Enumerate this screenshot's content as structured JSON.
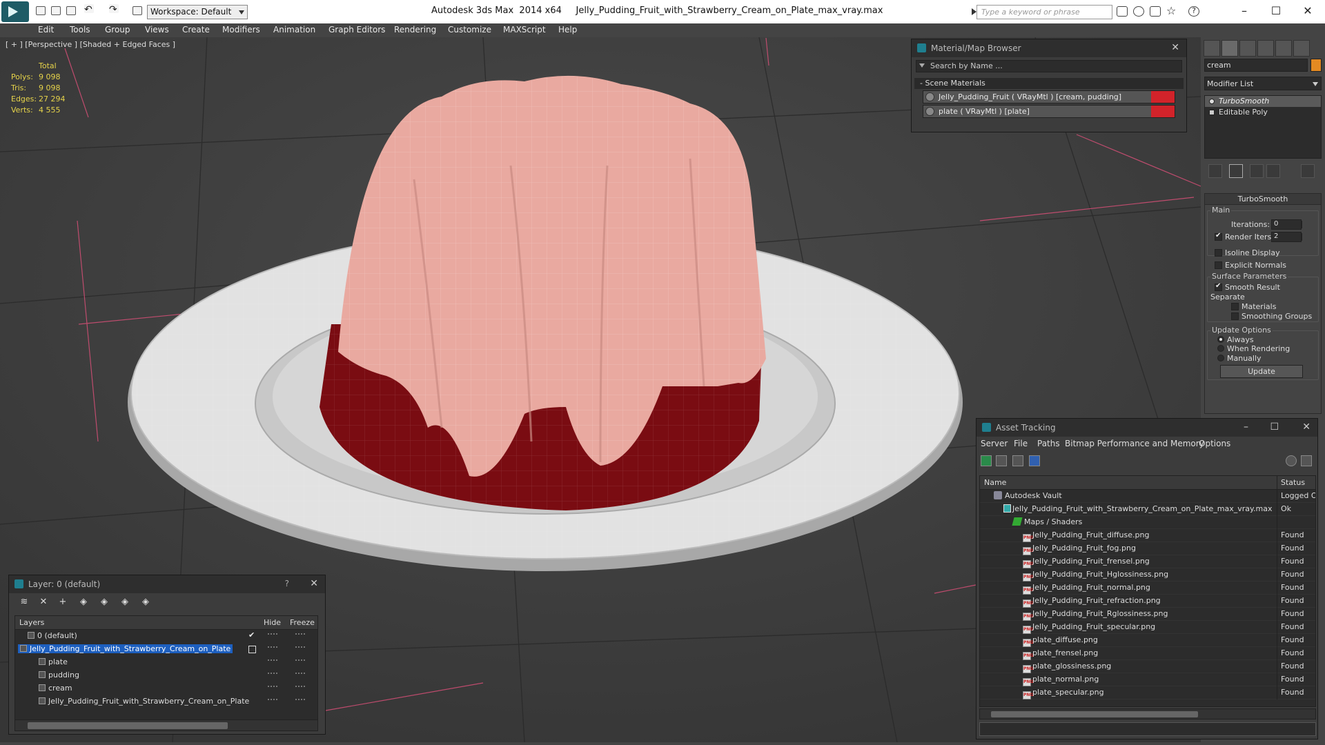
{
  "titlebar": {
    "workspace": "Workspace: Default",
    "app_title": "Autodesk 3ds Max  2014 x64     Jelly_Pudding_Fruit_with_Strawberry_Cream_on_Plate_max_vray.max",
    "search_placeholder": "Type a keyword or phrase"
  },
  "menu": [
    "Edit",
    "Tools",
    "Group",
    "Views",
    "Create",
    "Modifiers",
    "Animation",
    "Graph Editors",
    "Rendering",
    "Customize",
    "MAXScript",
    "Help"
  ],
  "viewport": {
    "label": "[ + ] [Perspective ] [Shaded + Edged Faces ]",
    "stats": {
      "header": "Total",
      "rows": [
        {
          "label": "Polys:",
          "value": "9 098"
        },
        {
          "label": "Tris:",
          "value": "9 098"
        },
        {
          "label": "Edges:",
          "value": "27 294"
        },
        {
          "label": "Verts:",
          "value": "4 555"
        }
      ]
    }
  },
  "material_browser": {
    "title": "Material/Map Browser",
    "search_placeholder": "Search by Name ...",
    "section": "- Scene Materials",
    "materials": [
      {
        "label": "Jelly_Pudding_Fruit  ( VRayMtl )  [cream, pudding]",
        "color": "#d2232a"
      },
      {
        "label": "plate  ( VRayMtl )  [plate]",
        "color": "#d2232a"
      }
    ]
  },
  "command_panel": {
    "object_name": "cream",
    "object_color": "#e48a22",
    "modifier_list": "Modifier List",
    "stack": [
      "TurboSmooth",
      "Editable Poly"
    ],
    "rollout_title": "TurboSmooth",
    "main_label": "Main",
    "iterations_label": "Iterations:",
    "iterations_value": "0",
    "render_iters_label": "Render Iters:",
    "render_iters_value": "2",
    "isoline": "Isoline Display",
    "explicit": "Explicit Normals",
    "surface_label": "Surface Parameters",
    "smooth_result": "Smooth Result",
    "separate_label": "Separate",
    "materials": "Materials",
    "smoothing_groups": "Smoothing Groups",
    "update_label": "Update Options",
    "always": "Always",
    "when_rendering": "When Rendering",
    "manually": "Manually",
    "update_button": "Update"
  },
  "layer_panel": {
    "title": "Layer: 0 (default)",
    "help": "?",
    "columns": {
      "layers": "Layers",
      "hide": "Hide",
      "freeze": "Freeze"
    },
    "rows": [
      {
        "name": "0 (default)",
        "level": 0
      },
      {
        "name": "Jelly_Pudding_Fruit_with_Strawberry_Cream_on_Plate",
        "level": 0
      },
      {
        "name": "plate",
        "level": 1
      },
      {
        "name": "pudding",
        "level": 1
      },
      {
        "name": "cream",
        "level": 1
      },
      {
        "name": "Jelly_Pudding_Fruit_with_Strawberry_Cream_on_Plate",
        "level": 1
      }
    ]
  },
  "asset_tracking": {
    "title": "Asset Tracking",
    "menu": [
      "Server",
      "File",
      "Paths",
      "Bitmap Performance and Memory",
      "Options"
    ],
    "columns": {
      "name": "Name",
      "status": "Status"
    },
    "rows": [
      {
        "name": "Autodesk Vault",
        "status": "Logged O",
        "kind": "vault",
        "level": 1
      },
      {
        "name": "Jelly_Pudding_Fruit_with_Strawberry_Cream_on_Plate_max_vray.max",
        "status": "Ok",
        "kind": "file",
        "level": 2
      },
      {
        "name": "Maps / Shaders",
        "status": "",
        "kind": "maps",
        "level": 3
      },
      {
        "name": "Jelly_Pudding_Fruit_diffuse.png",
        "status": "Found",
        "kind": "png",
        "level": 4
      },
      {
        "name": "Jelly_Pudding_Fruit_fog.png",
        "status": "Found",
        "kind": "png",
        "level": 4
      },
      {
        "name": "Jelly_Pudding_Fruit_frensel.png",
        "status": "Found",
        "kind": "png",
        "level": 4
      },
      {
        "name": "Jelly_Pudding_Fruit_Hglossiness.png",
        "status": "Found",
        "kind": "png",
        "level": 4
      },
      {
        "name": "Jelly_Pudding_Fruit_normal.png",
        "status": "Found",
        "kind": "png",
        "level": 4
      },
      {
        "name": "Jelly_Pudding_Fruit_refraction.png",
        "status": "Found",
        "kind": "png",
        "level": 4
      },
      {
        "name": "Jelly_Pudding_Fruit_Rglossiness.png",
        "status": "Found",
        "kind": "png",
        "level": 4
      },
      {
        "name": "Jelly_Pudding_Fruit_specular.png",
        "status": "Found",
        "kind": "png",
        "level": 4
      },
      {
        "name": "plate_diffuse.png",
        "status": "Found",
        "kind": "png",
        "level": 4
      },
      {
        "name": "plate_frensel.png",
        "status": "Found",
        "kind": "png",
        "level": 4
      },
      {
        "name": "plate_glossiness.png",
        "status": "Found",
        "kind": "png",
        "level": 4
      },
      {
        "name": "plate_normal.png",
        "status": "Found",
        "kind": "png",
        "level": 4
      },
      {
        "name": "plate_specular.png",
        "status": "Found",
        "kind": "png",
        "level": 4
      }
    ]
  }
}
